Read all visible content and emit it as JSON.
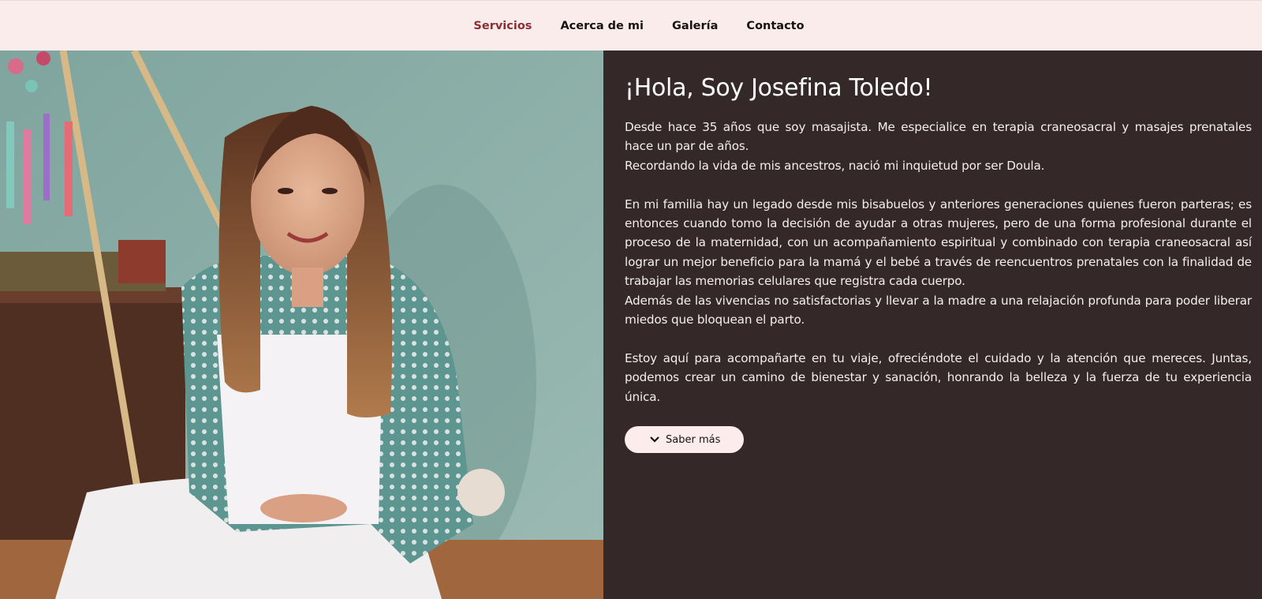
{
  "nav": {
    "items": [
      {
        "label": "Servicios",
        "active": true
      },
      {
        "label": "Acerca de mi",
        "active": false
      },
      {
        "label": "Galería",
        "active": false
      },
      {
        "label": "Contacto",
        "active": false
      }
    ]
  },
  "hero": {
    "photo_alt": "Josefina Toledo"
  },
  "about": {
    "title": "¡Hola, Soy Josefina Toledo!",
    "p1_line1": "Desde hace 35 años que soy masajista. Me especialice en terapia craneosacral y masajes prenatales hace un par de años.",
    "p1_line2": "Recordando la vida de mis ancestros, nació mi inquietud por ser Doula.",
    "p2": "En mi familia hay un legado desde mis bisabuelos y anteriores generaciones quienes fueron parteras; es entonces cuando tomo la decisión de ayudar a otras mujeres, pero de una forma profesional durante el proceso de la maternidad, con un acompañamiento espiritual y combinado con terapia craneosacral así lograr un mejor beneficio para la mamá y el bebé a través de reencuentros prenatales con la finalidad de trabajar las memorias celulares que registra cada cuerpo.",
    "p3": "Además de las vivencias no satisfactorias y llevar a la madre a una relajación profunda para poder liberar miedos que bloquean el parto.",
    "p4": "Estoy aquí para acompañarte en tu viaje, ofreciéndote el cuidado y la atención que mereces. Juntas, podemos crear un camino de bienestar y sanación, honrando la belleza y la fuerza de tu experiencia única.",
    "button_label": "Saber más",
    "button_icon": "chevron-down-icon"
  },
  "colors": {
    "nav_bg": "#fbecec",
    "active_link": "#8c2f35",
    "panel_bg": "#342828",
    "button_bg": "#fcecec"
  }
}
